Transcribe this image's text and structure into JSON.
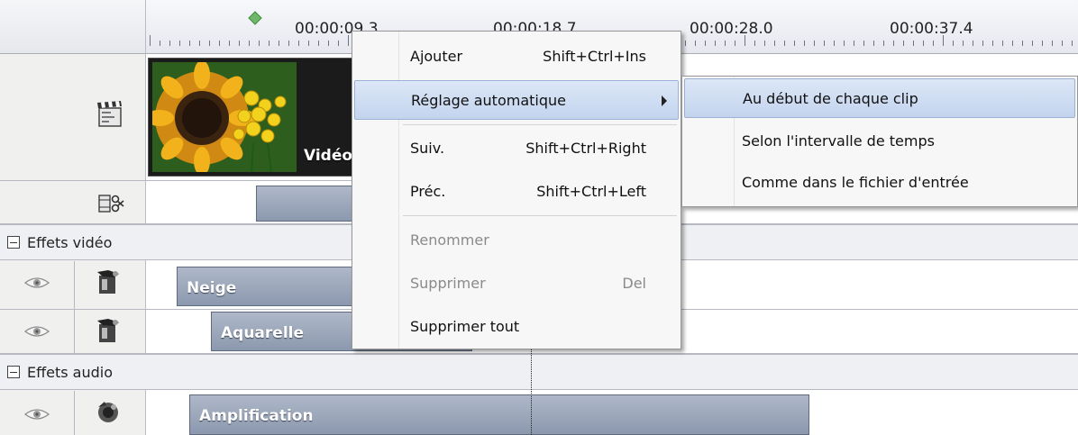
{
  "ruler": {
    "time_labels": [
      "00:00:09.3",
      "00:00:18.7",
      "00:00:28.0",
      "00:00:37.4"
    ]
  },
  "sections": {
    "video_effects": "Effets vidéo",
    "audio_effects": "Effets audio"
  },
  "clips": {
    "video_clip": "Vidéo",
    "effect_1": "Neige",
    "effect_2": "Aquarelle",
    "audio_effect": "Amplification"
  },
  "context_menu": {
    "items": [
      {
        "label": "Ajouter",
        "shortcut": "Shift+Ctrl+Ins",
        "enabled": true
      },
      {
        "label": "Réglage automatique",
        "shortcut": "",
        "enabled": true,
        "submenu": true,
        "highlighted": true
      },
      {
        "label": "Suiv.",
        "shortcut": "Shift+Ctrl+Right",
        "enabled": true
      },
      {
        "label": "Préc.",
        "shortcut": "Shift+Ctrl+Left",
        "enabled": true
      },
      {
        "label": "Renommer",
        "shortcut": "",
        "enabled": false
      },
      {
        "label": "Supprimer",
        "shortcut": "Del",
        "enabled": false
      },
      {
        "label": "Supprimer tout",
        "shortcut": "",
        "enabled": true
      }
    ]
  },
  "submenu": {
    "items": [
      {
        "label": "Au début de chaque clip",
        "highlighted": true
      },
      {
        "label": "Selon l'intervalle de temps",
        "highlighted": false
      },
      {
        "label": "Comme dans le fichier d'entrée",
        "highlighted": false
      }
    ]
  },
  "colors": {
    "clip_fill": "#9aa5b9",
    "menu_highlight": "#c9d8ef",
    "panel_bg": "#f0f0ee",
    "marker_green": "#6fb86a"
  },
  "icons": [
    "clapperboard-icon",
    "scissors-film-icon",
    "eye-icon",
    "effect-icon",
    "audio-effect-icon",
    "collapse-icon",
    "submenu-arrow-icon",
    "playhead-marker-icon"
  ]
}
